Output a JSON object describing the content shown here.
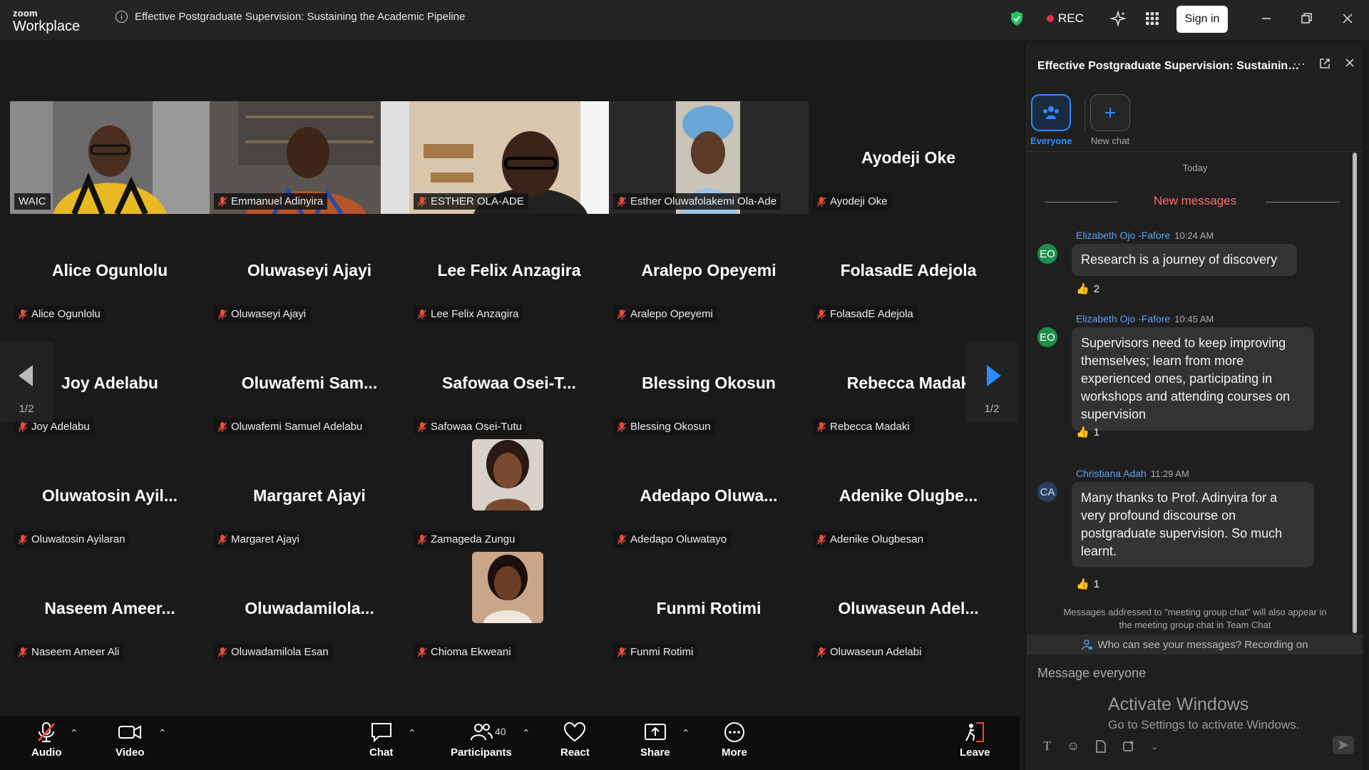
{
  "app": {
    "logo_line1": "zoom",
    "logo_line2": "Workplace",
    "meeting_title": "Effective Postgraduate Supervision: Sustaining the Academic Pipeline",
    "rec_label": "REC",
    "signin_label": "Sign in"
  },
  "grid": {
    "page_indicator": "1/2",
    "more_label": "...",
    "tiles": [
      {
        "label": "WAIC",
        "big": ""
      },
      {
        "label": "Emmanuel Adinyira",
        "big": ""
      },
      {
        "label": "ESTHER OLA-ADE",
        "big": ""
      },
      {
        "label": "Esther Oluwafolakemi Ola-Ade",
        "big": ""
      },
      {
        "label": "Ayodeji Oke",
        "big": "Ayodeji Oke"
      },
      {
        "label": "Alice Ogunlolu",
        "big": "Alice Ogunlolu"
      },
      {
        "label": "Oluwaseyi Ajayi",
        "big": "Oluwaseyi Ajayi"
      },
      {
        "label": "Lee Felix Anzagira",
        "big": "Lee Felix Anzagira"
      },
      {
        "label": "Aralepo Opeyemi",
        "big": "Aralepo Opeyemi"
      },
      {
        "label": "FolasadE Adejola",
        "big": "FolasadE Adejola"
      },
      {
        "label": "Joy Adelabu",
        "big": "Joy Adelabu"
      },
      {
        "label": "Oluwafemi Samuel Adelabu",
        "big": "Oluwafemi  Sam..."
      },
      {
        "label": "Safowaa Osei-Tutu",
        "big": "Safowaa  Osei-T..."
      },
      {
        "label": "Blessing Okosun",
        "big": "Blessing Okosun"
      },
      {
        "label": "Rebecca Madaki",
        "big": "Rebecca Madak"
      },
      {
        "label": "Oluwatosin Ayilaran",
        "big": "Oluwatosin  Ayil..."
      },
      {
        "label": "Margaret Ajayi",
        "big": "Margaret Ajayi"
      },
      {
        "label": "Zamageda Zungu",
        "big": ""
      },
      {
        "label": "Adedapo Oluwatayo",
        "big": "Adedapo  Oluwa..."
      },
      {
        "label": "Adenike Olugbesan",
        "big": "Adenike  Olugbe..."
      },
      {
        "label": "Naseem Ameer Ali",
        "big": "Naseem  Ameer..."
      },
      {
        "label": "Oluwadamilola Esan",
        "big": "Oluwadamilola..."
      },
      {
        "label": "Chioma Ekweani",
        "big": ""
      },
      {
        "label": "Funmi Rotimi",
        "big": "Funmi Rotimi"
      },
      {
        "label": "Oluwaseun Adelabi",
        "big": "Oluwaseun  Adel..."
      }
    ]
  },
  "toolbar": {
    "audio": "Audio",
    "video": "Video",
    "chat": "Chat",
    "participants": "Participants",
    "participants_count": "40",
    "react": "React",
    "share": "Share",
    "more": "More",
    "leave": "Leave"
  },
  "chat": {
    "header": "Effective Postgraduate Supervision: Sustaining the Academic Pipeline",
    "channel_everyone": "Everyone",
    "channel_new": "New chat",
    "today": "Today",
    "new_messages": "New messages",
    "messages": [
      {
        "initials": "EO",
        "sender": "Elizabeth Ojo -Fafore",
        "time": "10:24 AM",
        "text": "Research is a journey of discovery",
        "reaction": "2"
      },
      {
        "initials": "EO",
        "sender": "Elizabeth Ojo -Fafore",
        "time": "10:45 AM",
        "text": "Supervisors need to keep improving themselves; learn from more experienced ones, participating in workshops and attending courses on supervision",
        "reaction": "1"
      },
      {
        "initials": "CA",
        "sender": "Christiana Adah",
        "time": "11:29 AM",
        "text": "Many thanks to Prof. Adinyira for a very profound discourse on postgraduate supervision. So much learnt.",
        "reaction": "1"
      }
    ],
    "footnote": "Messages addressed to \"meeting group chat\" will also appear in the meeting group chat in Team Chat",
    "who_can_see": "Who can see your messages? Recording on",
    "input_placeholder": "Message everyone",
    "activate_title": "Activate Windows",
    "activate_sub": "Go to Settings to activate Windows."
  },
  "colors": {
    "accent": "#1a73e8",
    "active_speaker": "#23d160",
    "rec": "#e8304f",
    "new_messages": "#ff6b6b",
    "sender_name": "#5ea0f0"
  }
}
